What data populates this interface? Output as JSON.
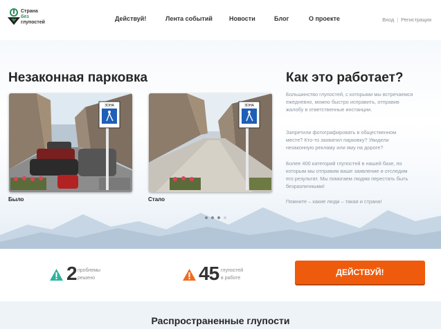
{
  "header": {
    "logo": {
      "line1": "Страна",
      "line2_accent": "без",
      "line2_rest": " глупостей",
      "brand_green": "#2e8b57"
    },
    "nav": [
      "Действуй!",
      "Лента событий",
      "Новости",
      "Блог",
      "О проекте"
    ],
    "auth": {
      "login": "Вход",
      "separator": "|",
      "register": "Регистрация"
    }
  },
  "hero": {
    "title": "Незаконная парковка",
    "before_label": "Было",
    "after_label": "Стало",
    "sign_text": "ЗОНА",
    "slider": {
      "dot_count": 4,
      "active_index": 3
    },
    "how": {
      "title": "Как это работает?",
      "paragraphs": [
        "Большинство глупостей, с которыми мы встречаемся ежедневно, можно быстро исправить, отправив жалобу в ответственные инстанции.",
        "Запретили фотографировать в общественном месте? Кто-то захватил парковку? Увидели незаконную рекламу или яму на дороге?",
        "Более 400 категорий глупостей в нашей базе, по которым мы отправим ваше заявление и отследим его результат. Мы помогаем людям перестать быть безразличными!",
        "Помните – какие люди – такая и страна!"
      ]
    }
  },
  "stats": {
    "solved": {
      "number": "2",
      "line1": "проблемы",
      "line2": "решено",
      "icon": "warning-triangle-icon",
      "color": "#2db39e"
    },
    "in_progress": {
      "number": "45",
      "line1": "глупостей",
      "line2": "в работе",
      "icon": "warning-triangle-icon",
      "color": "#ef6a1f"
    },
    "cta_label": "ДЕЙСТВУЙ!",
    "cta_color": "#ef5b0c"
  },
  "section": {
    "title": "Распространенные глупости"
  }
}
